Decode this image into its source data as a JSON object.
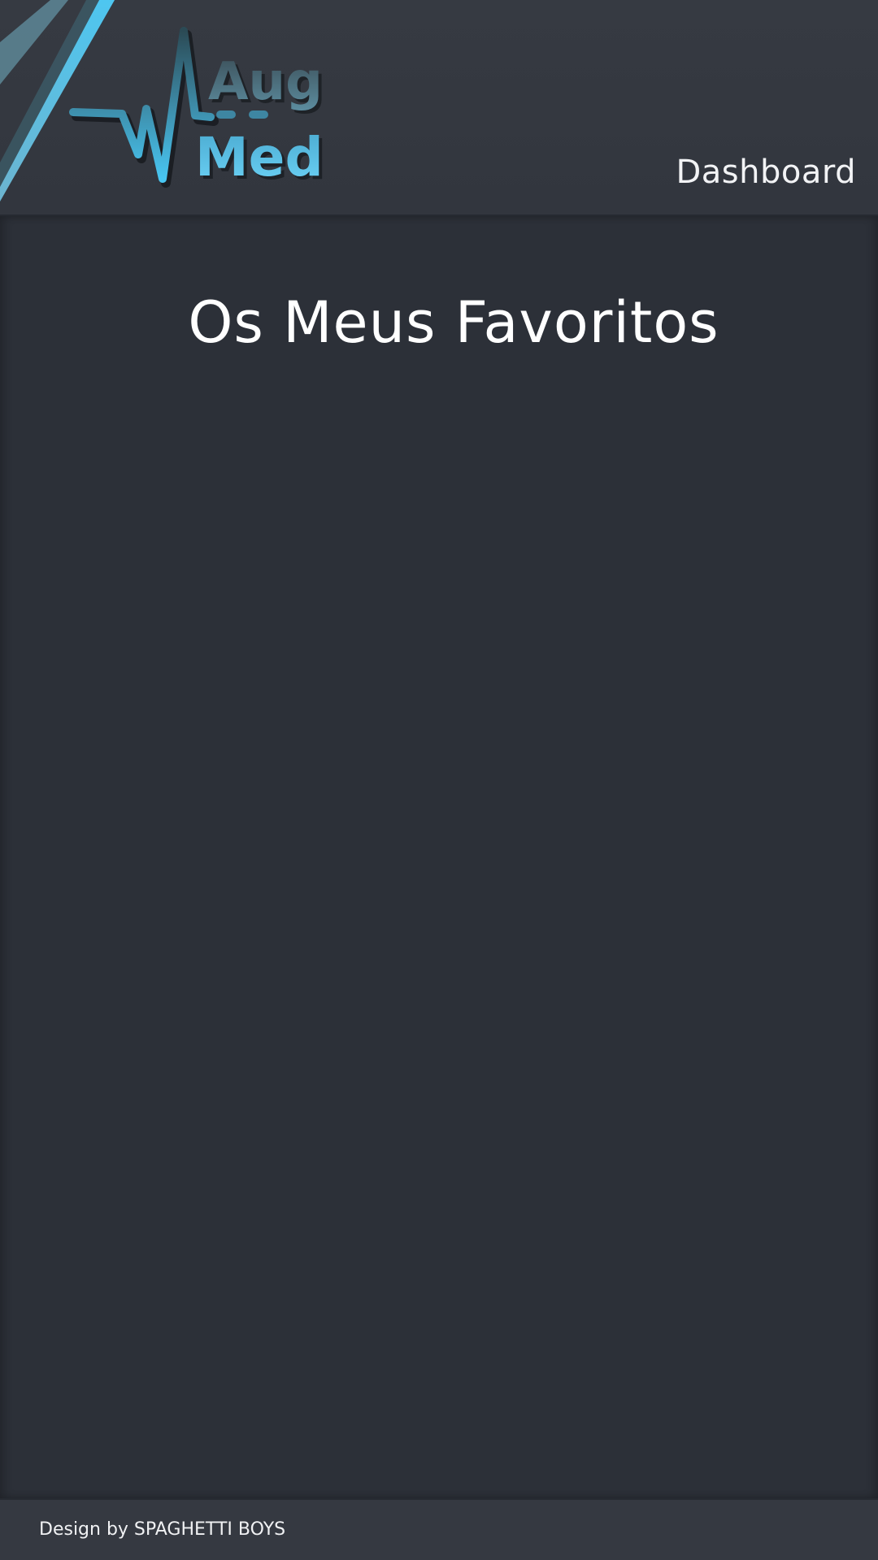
{
  "header": {
    "logo": {
      "word_top": "Aug",
      "word_bottom": "Med",
      "icon": "heartbeat-pulse-icon"
    },
    "nav": {
      "dashboard_label": "Dashboard"
    }
  },
  "main": {
    "title": "Os Meus Favoritos",
    "favorites": []
  },
  "footer": {
    "credit": "Design by SPAGHETTI BOYS"
  },
  "colors": {
    "background": "#2c3038",
    "header": "#363a42",
    "footer": "#353941",
    "accent": "#47c3ee",
    "text": "#ffffff"
  }
}
